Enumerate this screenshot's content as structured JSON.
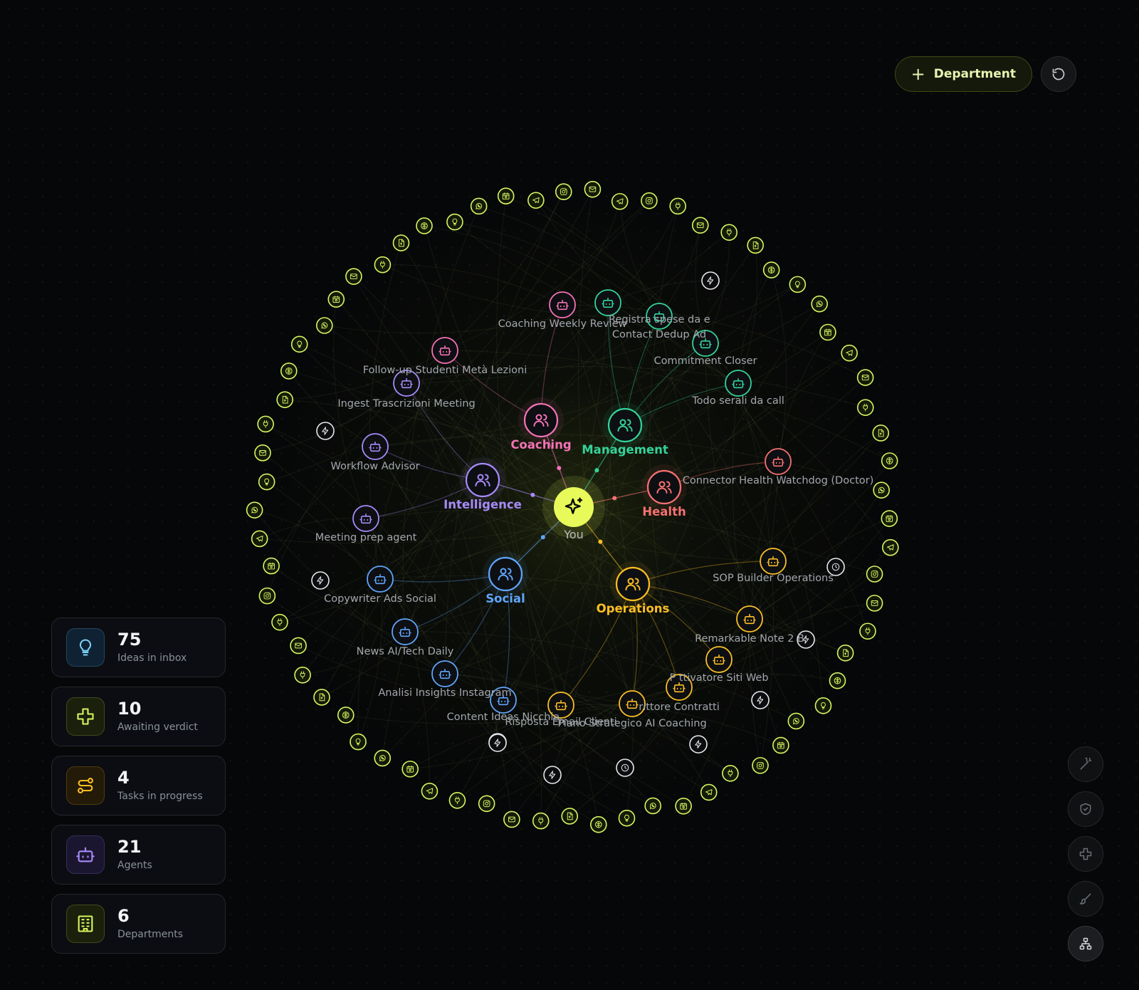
{
  "toolbar": {
    "department_button_label": "Department",
    "department_button_icon": "plus-icon",
    "reset_icon": "refresh-icon"
  },
  "stats": [
    {
      "value": "75",
      "label": "Ideas in inbox",
      "icon": "lightbulb-icon",
      "color": "#7dd3fc"
    },
    {
      "value": "10",
      "label": "Awaiting verdict",
      "icon": "medical-cross-icon",
      "color": "#d9f562"
    },
    {
      "value": "4",
      "label": "Tasks in progress",
      "icon": "route-icon",
      "color": "#fbbf24"
    },
    {
      "value": "21",
      "label": "Agents",
      "icon": "robot-icon",
      "color": "#a78bfa"
    },
    {
      "value": "6",
      "label": "Departments",
      "icon": "building-icon",
      "color": "#d9f562"
    }
  ],
  "side_tools": [
    {
      "icon": "magic-wand-icon",
      "active": false
    },
    {
      "icon": "shield-icon",
      "active": false
    },
    {
      "icon": "medical-cross-icon",
      "active": false
    },
    {
      "icon": "brush-icon",
      "active": false
    },
    {
      "icon": "hierarchy-icon",
      "active": true
    }
  ],
  "colors": {
    "accent": "#e8fa5a",
    "coaching": "#f472b6",
    "management": "#34d399",
    "health": "#f87171",
    "intelligence": "#a78bfa",
    "social": "#60a5fa",
    "operations": "#fbbf24",
    "integration": "#d9f562",
    "trigger": "#e5e7eb"
  },
  "graph": {
    "center": {
      "label": "You",
      "icon": "sparkles-icon"
    },
    "departments": [
      {
        "id": "coaching",
        "label": "Coaching",
        "color": "#f472b6",
        "icon": "users-icon"
      },
      {
        "id": "management",
        "label": "Management",
        "color": "#34d399",
        "icon": "users-icon"
      },
      {
        "id": "health",
        "label": "Health",
        "color": "#f87171",
        "icon": "users-icon"
      },
      {
        "id": "intelligence",
        "label": "Intelligence",
        "color": "#a78bfa",
        "icon": "users-icon"
      },
      {
        "id": "social",
        "label": "Social",
        "color": "#60a5fa",
        "icon": "users-icon"
      },
      {
        "id": "operations",
        "label": "Operations",
        "color": "#fbbf24",
        "icon": "users-icon"
      }
    ],
    "agents": [
      {
        "label": "Coaching Weekly Review",
        "dept": "coaching"
      },
      {
        "label": "Follow-up Studenti Metà Lezioni",
        "dept": "coaching"
      },
      {
        "label": "Registra spese da e",
        "dept": "management"
      },
      {
        "label": "Contact Dedup Ad",
        "dept": "management"
      },
      {
        "label": "Commitment Closer",
        "dept": "management"
      },
      {
        "label": "Todo serali da call",
        "dept": "management"
      },
      {
        "label": "Connector Health Watchdog (Doctor)",
        "dept": "health"
      },
      {
        "label": "Ingest Trascrizioni Meeting",
        "dept": "intelligence"
      },
      {
        "label": "Workflow Advisor",
        "dept": "intelligence"
      },
      {
        "label": "Meeting prep agent",
        "dept": "intelligence"
      },
      {
        "label": "Copywriter Ads Social",
        "dept": "social"
      },
      {
        "label": "News AI/Tech Daily",
        "dept": "social"
      },
      {
        "label": "Analisi Insights Instagram",
        "dept": "social"
      },
      {
        "label": "Content Ideas Nicchia",
        "dept": "social"
      },
      {
        "label": "SOP Builder Operations",
        "dept": "operations"
      },
      {
        "label": "Remarkable Note 2 B",
        "dept": "operations"
      },
      {
        "label": "P  ttivatore Siti Web",
        "dept": "operations"
      },
      {
        "label": "rittore Contratti",
        "dept": "operations"
      },
      {
        "label": "Risposta Email Clienti",
        "dept": "operations"
      },
      {
        "label": "Piano Strategico AI Coaching",
        "dept": "operations"
      }
    ],
    "integration_icons": [
      "telegram-icon",
      "instagram-icon",
      "plug-icon",
      "mail-icon",
      "plug-icon",
      "file-icon",
      "brain-icon",
      "lightbulb-icon",
      "whatsapp-icon",
      "calendar-icon",
      "telegram-icon",
      "mail-icon",
      "plug-icon",
      "file-icon",
      "brain-icon",
      "whatsapp-icon",
      "calendar-icon",
      "telegram-icon",
      "instagram-icon",
      "mail-icon",
      "plug-icon",
      "file-icon",
      "brain-icon",
      "lightbulb-icon",
      "whatsapp-icon",
      "calendar-icon",
      "instagram-icon",
      "plug-icon",
      "telegram-icon",
      "calendar-icon",
      "whatsapp-icon",
      "lightbulb-icon",
      "brain-icon",
      "file-icon",
      "plug-icon",
      "mail-icon",
      "instagram-icon",
      "plug-icon",
      "telegram-icon",
      "calendar-icon",
      "whatsapp-icon",
      "lightbulb-icon",
      "brain-icon",
      "file-icon",
      "plug-icon",
      "mail-icon",
      "plug-icon",
      "instagram-icon",
      "calendar-icon",
      "telegram-icon",
      "whatsapp-icon",
      "lightbulb-icon",
      "mail-icon",
      "plug-icon",
      "file-icon",
      "brain-icon",
      "lightbulb-icon",
      "whatsapp-icon",
      "calendar-icon",
      "mail-icon",
      "plug-icon",
      "file-icon",
      "brain-icon",
      "lightbulb-icon",
      "whatsapp-icon",
      "calendar-icon",
      "telegram-icon",
      "instagram-icon",
      "mail-icon"
    ],
    "trigger_icons": [
      "lightning-icon",
      "lightning-icon",
      "lightning-icon",
      "clock-icon",
      "lightning-icon",
      "lightning-icon",
      "lightning-icon",
      "clock-icon",
      "lightning-icon",
      "lightning-icon",
      "lightning-icon"
    ]
  }
}
